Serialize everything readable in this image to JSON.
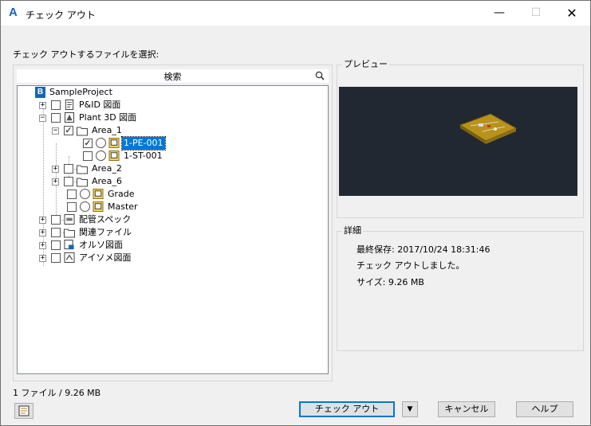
{
  "window": {
    "title": "チェック アウト",
    "minimize": "—",
    "maximize": "☐",
    "close": "✕"
  },
  "prompt": "チェック アウトするファイルを選択:",
  "search": {
    "label": "検索"
  },
  "tree": {
    "root": "SampleProject",
    "root_badge": "B",
    "pid": "P&ID 図面",
    "plant3d": "Plant 3D 図面",
    "area1": "Area_1",
    "pe001": "1-PE-001",
    "st001": "1-ST-001",
    "area2": "Area_2",
    "area6": "Area_6",
    "grade": "Grade",
    "master": "Master",
    "piping_spec": "配管スペック",
    "related_files": "関連ファイル",
    "ortho": "オルソ図面",
    "iso": "アイソメ図面"
  },
  "preview": {
    "title": "プレビュー"
  },
  "details": {
    "title": "詳細",
    "last_saved": "最終保存: 2017/10/24 18:31:46",
    "status": "チェック アウトしました。",
    "size": "サイズ: 9.26 MB"
  },
  "footer": {
    "count": "1 ファイル / 9.26 MB",
    "checkout": "チェック アウト",
    "dropdown": "▼",
    "cancel": "キャンセル",
    "help": "ヘルプ"
  },
  "colors": {
    "selection": "#0078d7",
    "preview_bg": "#222831",
    "model": "#b8921a",
    "accent": "#1a64b4"
  },
  "icons": [
    "autocad-app-icon",
    "search-icon",
    "folder-icon",
    "drawing-icon",
    "pid-icon",
    "plant3d-icon",
    "spec-icon",
    "ortho-icon",
    "iso-icon",
    "project-manager-icon"
  ]
}
